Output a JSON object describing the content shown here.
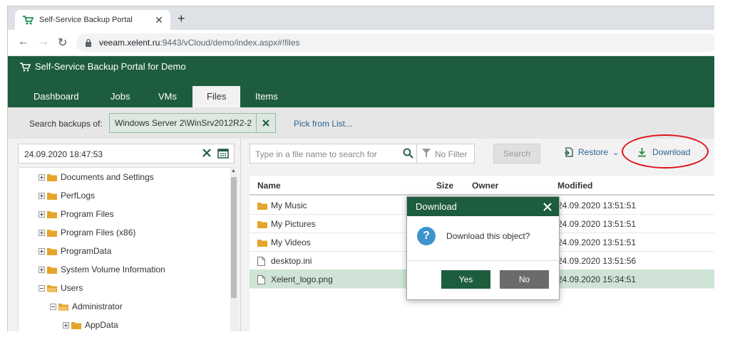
{
  "browser": {
    "tab_title": "Self-Service Backup Portal",
    "url_host": "veeam.xelent.ru",
    "url_path": ":9443/vCloud/demo/index.aspx#!files"
  },
  "app": {
    "title": "Self-Service Backup Portal for Demo",
    "tabs": [
      {
        "label": "Dashboard"
      },
      {
        "label": "Jobs"
      },
      {
        "label": "VMs"
      },
      {
        "label": "Files",
        "active": true
      },
      {
        "label": "Items"
      }
    ]
  },
  "search": {
    "label": "Search backups of:",
    "value": "Windows Server 2\\WinSrv2012R2-2",
    "pick_link": "Pick from List..."
  },
  "tree": {
    "date_value": "24.09.2020 18:47:53",
    "items": [
      {
        "label": "Documents and Settings"
      },
      {
        "label": "PerfLogs"
      },
      {
        "label": "Program Files"
      },
      {
        "label": "Program Files (x86)"
      },
      {
        "label": "ProgramData"
      },
      {
        "label": "System Volume Information"
      },
      {
        "label": "Users"
      },
      {
        "label": "Administrator"
      },
      {
        "label": "AppData"
      }
    ]
  },
  "files": {
    "search_placeholder": "Type in a file name to search for",
    "filter_label": "No Filter",
    "search_button": "Search",
    "restore_label": "Restore",
    "download_label": "Download",
    "columns": {
      "name": "Name",
      "size": "Size",
      "owner": "Owner",
      "modified": "Modified"
    },
    "rows": [
      {
        "name": "My Music",
        "modified": "24.09.2020 13:51:51",
        "type": "folder"
      },
      {
        "name": "My Pictures",
        "modified": "24.09.2020 13:51:51",
        "type": "folder"
      },
      {
        "name": "My Videos",
        "modified": "24.09.2020 13:51:51",
        "type": "folder"
      },
      {
        "name": "desktop.ini",
        "modified": "24.09.2020 13:51:56",
        "type": "file"
      },
      {
        "name": "Xelent_logo.png",
        "modified": "24.09.2020 15:34:51",
        "type": "file",
        "selected": true
      }
    ]
  },
  "dialog": {
    "title": "Download",
    "message": "Download this object?",
    "yes_label": "Yes",
    "no_label": "No"
  },
  "colors": {
    "brand": "#1e5c3e",
    "link": "#2a6496",
    "highlight": "#e0111b",
    "selected_row": "#cfe4d6"
  }
}
